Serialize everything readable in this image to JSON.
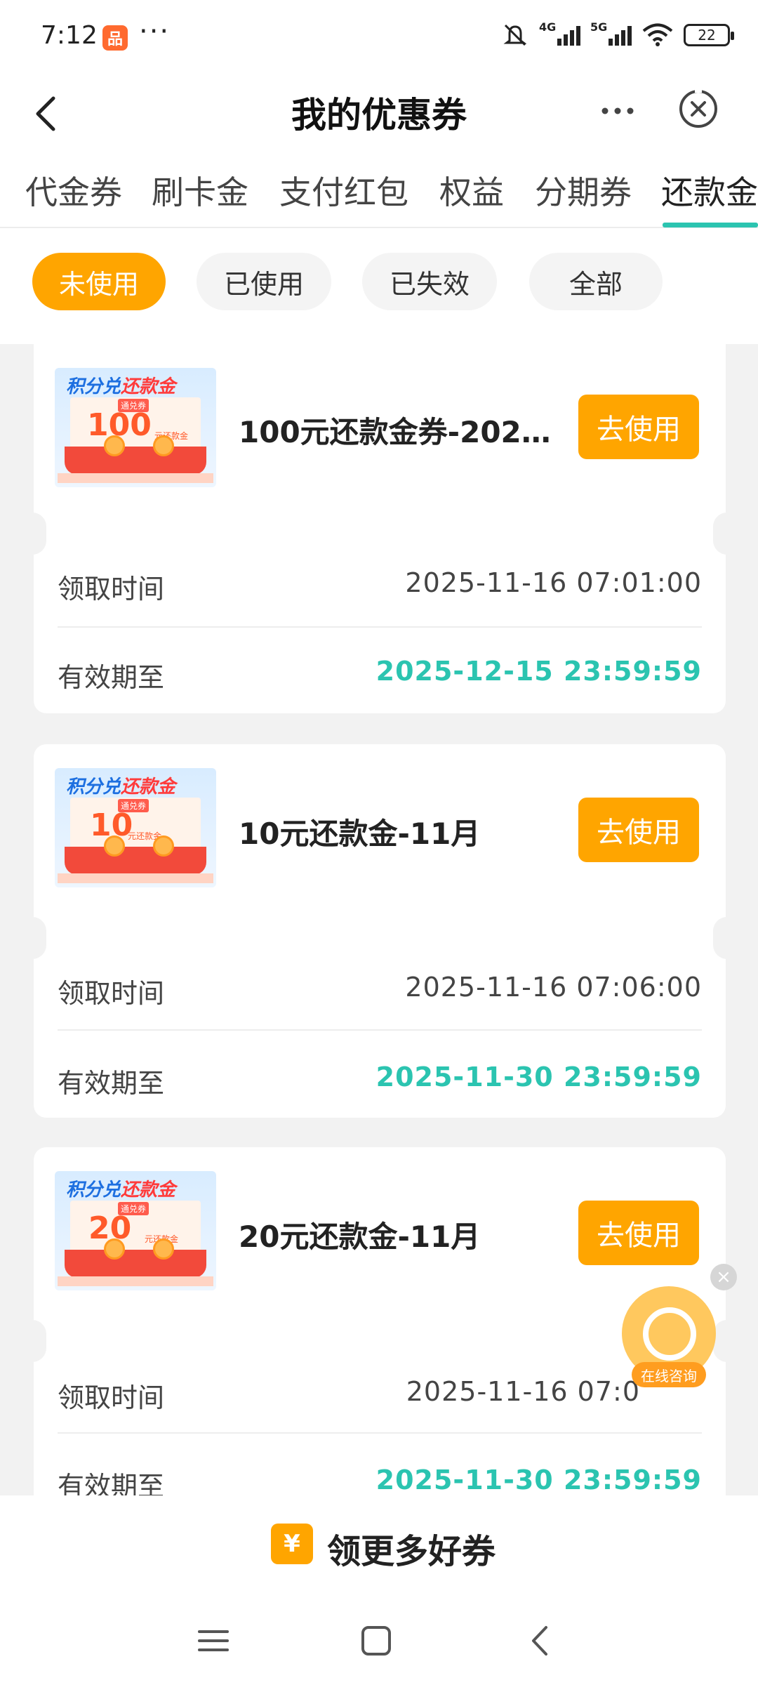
{
  "status": {
    "time": "7:12",
    "app_badge": "品",
    "dots": "···",
    "net1": "4G",
    "net2": "5G",
    "battery": "22"
  },
  "nav": {
    "title": "我的优惠券"
  },
  "tabs": [
    {
      "label": "代金券"
    },
    {
      "label": "刷卡金"
    },
    {
      "label": "支付红包"
    },
    {
      "label": "权益"
    },
    {
      "label": "分期券"
    },
    {
      "label": "还款金"
    }
  ],
  "filters": [
    {
      "label": "未使用"
    },
    {
      "label": "已使用"
    },
    {
      "label": "已失效"
    },
    {
      "label": "全部"
    }
  ],
  "thumb_text": {
    "brand1": "积分兑",
    "brand2": "还款金",
    "tag": "通兑券",
    "unit": "元还款金"
  },
  "coupons": [
    {
      "amount": "100",
      "name": "100元还款金券-2025...",
      "button": "去使用",
      "receive_label": "领取时间",
      "receive_time": "2025-11-16 07:01:00",
      "valid_label": "有效期至",
      "valid_until": "2025-12-15 23:59:59"
    },
    {
      "amount": "10",
      "name": "10元还款金-11月",
      "button": "去使用",
      "receive_label": "领取时间",
      "receive_time": "2025-11-16 07:06:00",
      "valid_label": "有效期至",
      "valid_until": "2025-11-30 23:59:59"
    },
    {
      "amount": "20",
      "name": "20元还款金-11月",
      "button": "去使用",
      "receive_label": "领取时间",
      "receive_time": "2025-11-16 07:0",
      "valid_label": "有效期至",
      "valid_until": "2025-11-30 23:59:59"
    }
  ],
  "consult": {
    "label": "在线咨询",
    "close": "×"
  },
  "bottom": {
    "icon": "¥",
    "label": "领更多好券"
  },
  "colors": {
    "accent": "#ffa500",
    "teal": "#2bc4b0",
    "background": "#f2f2f2"
  }
}
